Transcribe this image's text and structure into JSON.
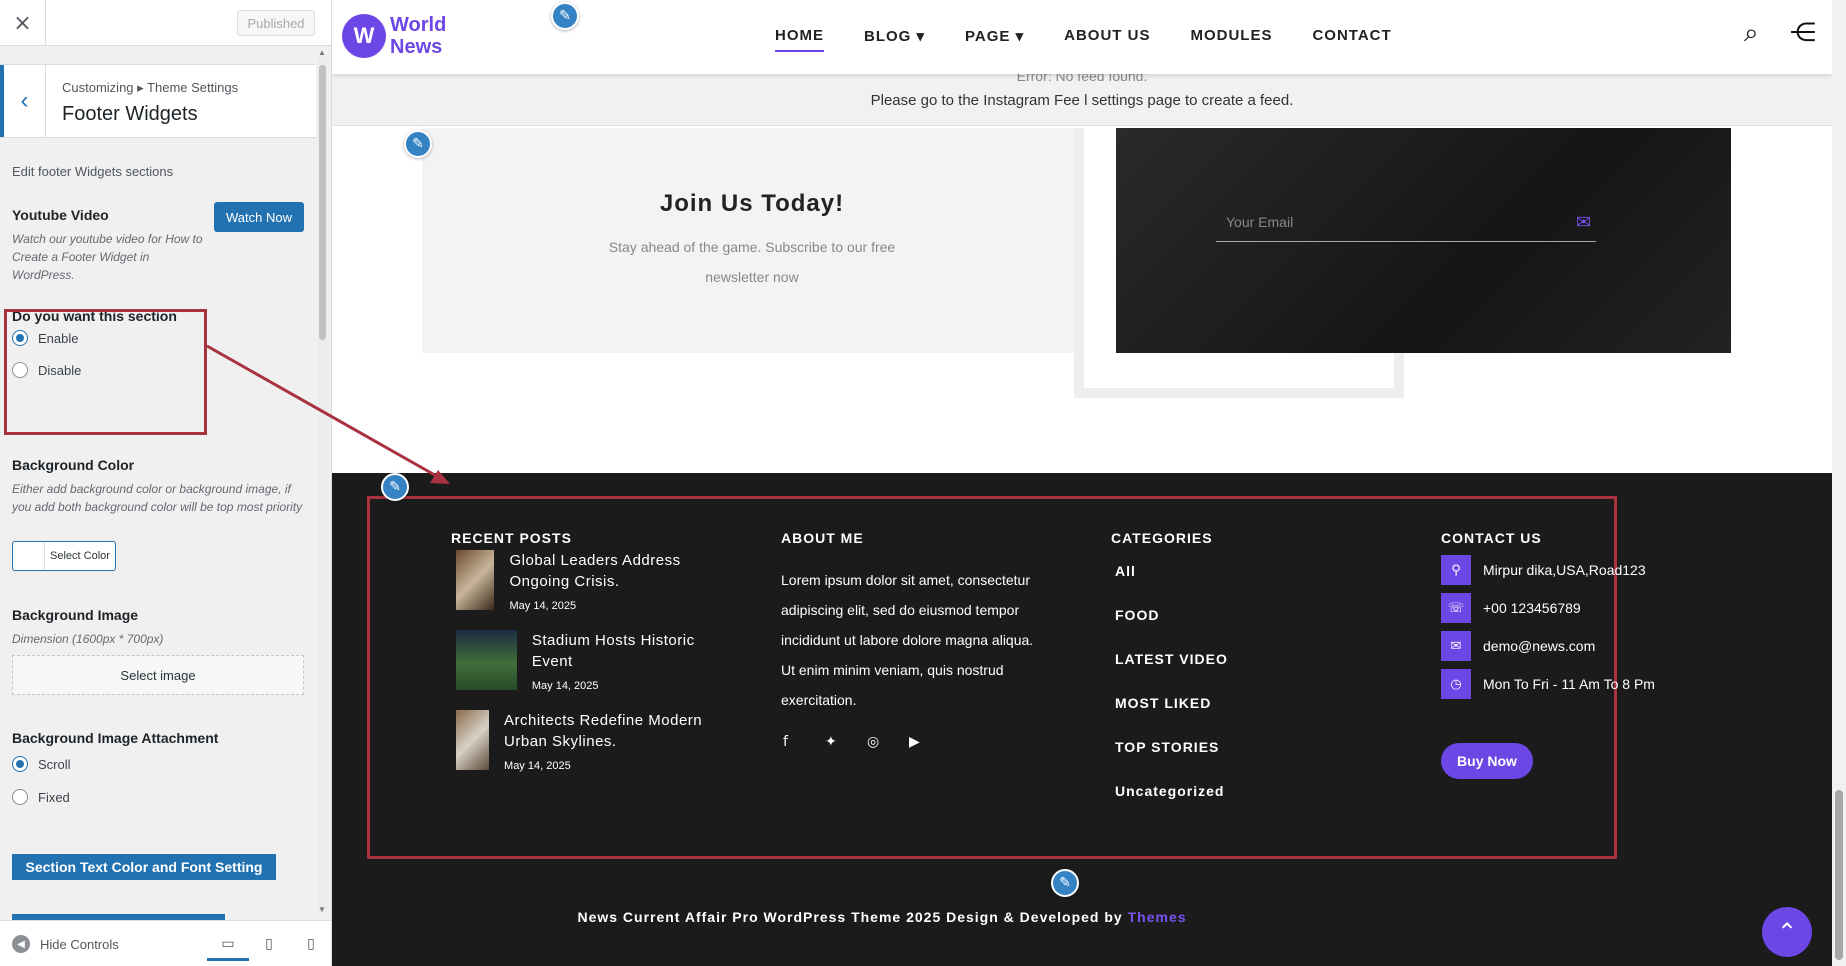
{
  "panel": {
    "close_label": "×",
    "publish_label": "Published",
    "breadcrumb": "Customizing ▸ Theme Settings",
    "section_title": "Footer Widgets",
    "intro": "Edit footer Widgets sections",
    "youtube": {
      "label": "Youtube Video",
      "desc": "Watch our youtube video for How to Create a Footer Widget in WordPress.",
      "button": "Watch Now"
    },
    "section_toggle": {
      "label": "Do you want this section",
      "options": [
        "Enable",
        "Disable"
      ],
      "selected": "Enable"
    },
    "background_color": {
      "label": "Background Color",
      "desc": "Either add background color or background image, if you add both background color will be top most priority",
      "button": "Select Color"
    },
    "background_image": {
      "label": "Background Image",
      "desc": "Dimension (1600px * 700px)",
      "button": "Select image"
    },
    "attachment": {
      "label": "Background Image Attachment",
      "options": [
        "Scroll",
        "Fixed"
      ],
      "selected": "Scroll"
    },
    "font_button": "Section Text Color and Font Setting",
    "hide_controls": "Hide Controls"
  },
  "site": {
    "logo_line1": "World",
    "logo_line2": "News",
    "nav": [
      "HOME",
      "BLOG ▾",
      "PAGE ▾",
      "ABOUT US",
      "MODULES",
      "CONTACT"
    ],
    "nav_active": "HOME",
    "instagram_error": "Error: No feed found.",
    "instagram_msg": "Please go to the Instagram Fee  l settings page to create a feed.",
    "join_title": "Join Us Today!",
    "join_text": "Stay ahead of the game. Subscribe to our free newsletter now",
    "email_placeholder": "Your Email",
    "footer": {
      "recent_posts": {
        "heading": "RECENT POSTS",
        "items": [
          {
            "title": "Global Leaders Address Ongoing Crisis.",
            "date": "May 14, 2025"
          },
          {
            "title": "Stadium Hosts Historic Event",
            "date": "May 14, 2025"
          },
          {
            "title": "Architects Redefine Modern Urban Skylines.",
            "date": "May 14, 2025"
          }
        ]
      },
      "about": {
        "heading": "ABOUT ME",
        "text": "Lorem ipsum dolor sit amet, consectetur adipiscing elit, sed do eiusmod tempor incididunt ut labore dolore magna aliqua. Ut enim minim veniam, quis nostrud exercitation."
      },
      "categories": {
        "heading": "CATEGORIES",
        "items": [
          "All",
          "FOOD",
          "LATEST VIDEO",
          "MOST LIKED",
          "TOP STORIES",
          "Uncategorized"
        ]
      },
      "contact": {
        "heading": "CONTACT US",
        "items": [
          {
            "icon": "location-icon",
            "text": "Mirpur dika,USA,Road123"
          },
          {
            "icon": "phone-icon",
            "text": "+00 123456789"
          },
          {
            "icon": "mail-icon",
            "text": "demo@news.com"
          },
          {
            "icon": "clock-icon",
            "text": "Mon To Fri - 11 Am To 8 Pm"
          }
        ],
        "button": "Buy Now"
      },
      "copyright": "News Current Affair Pro WordPress Theme 2025 Design & Developed by",
      "copyright_link": "Themes"
    }
  },
  "colors": {
    "accent": "#6c47e6",
    "wp_blue": "#2271b1",
    "highlight": "#a83240",
    "footer_bg": "#1b1b1b"
  }
}
